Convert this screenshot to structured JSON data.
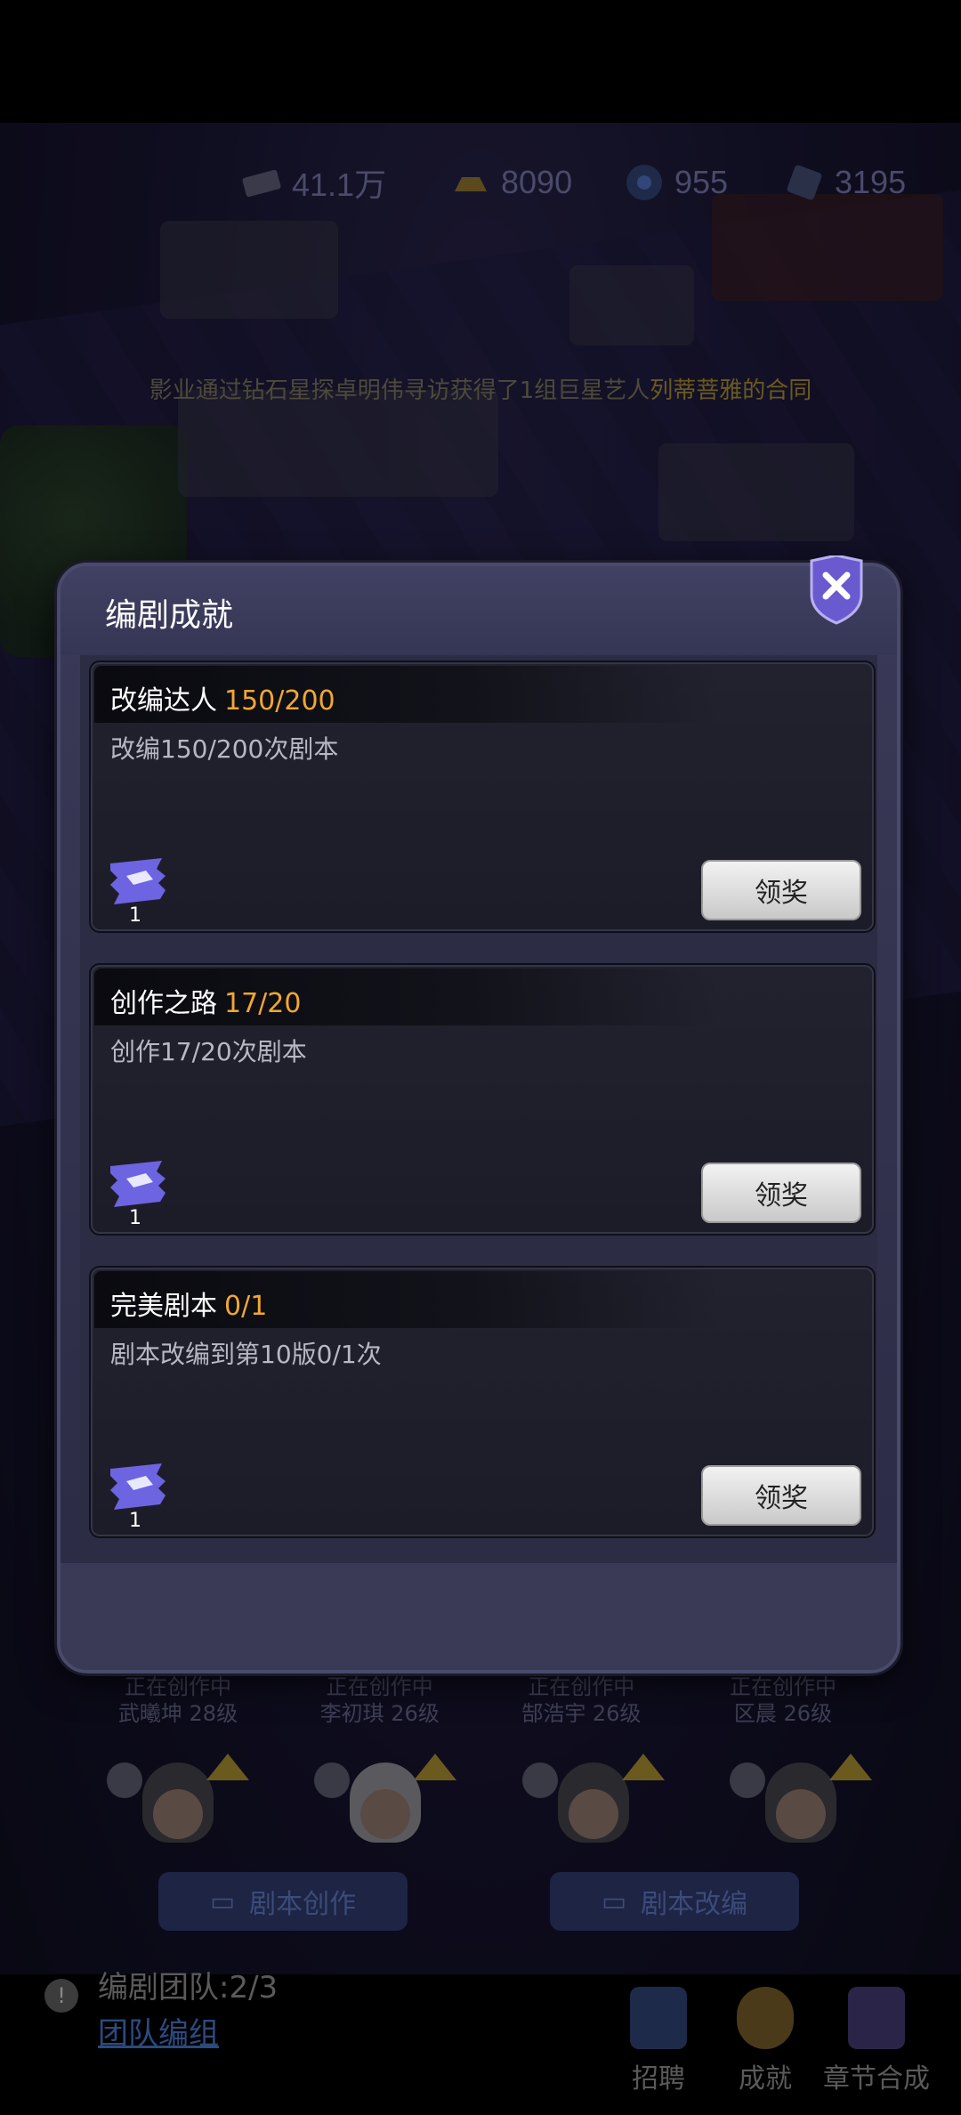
{
  "resources": [
    {
      "icon": "cash-icon",
      "value": "41.1万"
    },
    {
      "icon": "gold-ingot-icon",
      "value": "8090"
    },
    {
      "icon": "film-reel-icon",
      "value": "955"
    },
    {
      "icon": "ticket-icon",
      "value": "3195"
    }
  ],
  "broadcast": {
    "prefix": "",
    "text": "影业通过钻石星探卓明伟寻访获得了1组巨星艺人",
    "highlight": "列蒂菩雅的合同"
  },
  "modal": {
    "title": "编剧成就",
    "close_icon": "close-icon",
    "achievements": [
      {
        "name": "改编达人",
        "progress": "150/200",
        "desc": "改编150/200次剧本",
        "reward_icon": "script-ticket-icon",
        "reward_qty": "1",
        "button": "领奖"
      },
      {
        "name": "创作之路",
        "progress": "17/20",
        "desc": "创作17/20次剧本",
        "reward_icon": "script-ticket-icon",
        "reward_qty": "1",
        "button": "领奖"
      },
      {
        "name": "完美剧本",
        "progress": "0/1",
        "desc": "剧本改编到第10版0/1次",
        "reward_icon": "script-ticket-icon",
        "reward_qty": "1",
        "button": "领奖"
      }
    ]
  },
  "writers": [
    {
      "status": "正在创作中",
      "name": "武曦坤 28级"
    },
    {
      "status": "正在创作中",
      "name": "李初琪 26级"
    },
    {
      "status": "正在创作中",
      "name": "郜浩宇 26级"
    },
    {
      "status": "正在创作中",
      "name": "区晨 26级"
    }
  ],
  "actions": {
    "create": "剧本创作",
    "adapt": "剧本改编"
  },
  "team": {
    "label": "编剧团队:2/3",
    "link": "团队编组"
  },
  "nav": [
    {
      "label": "招聘",
      "icon": "recruit-icon"
    },
    {
      "label": "成就",
      "icon": "achievement-icon"
    },
    {
      "label": "章节合成",
      "icon": "chapter-merge-icon"
    }
  ],
  "colors": {
    "progress": "#f0a830",
    "panel": "#2a2a44",
    "card": "#1c1c28"
  }
}
